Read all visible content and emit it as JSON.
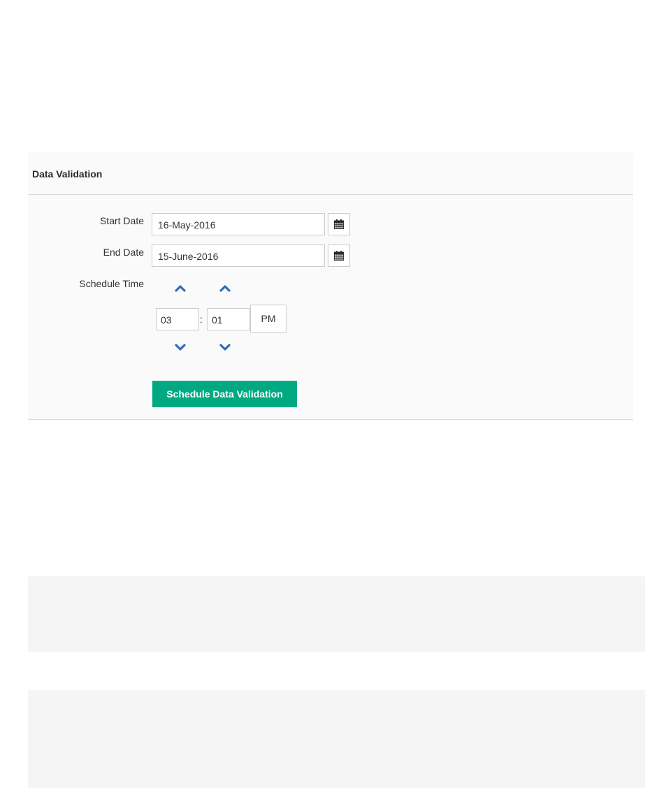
{
  "panel": {
    "title": "Data Validation"
  },
  "form": {
    "start_date": {
      "label": "Start Date",
      "value": "16-May-2016"
    },
    "end_date": {
      "label": "End Date",
      "value": "15-June-2016"
    },
    "schedule_time": {
      "label": "Schedule Time",
      "hour": "03",
      "separator": ":",
      "minute": "01",
      "period": "PM"
    },
    "submit_label": "Schedule Data Validation"
  },
  "icons": {
    "calendar": "calendar-icon",
    "increment": "chevron-up-icon",
    "decrement": "chevron-down-icon"
  },
  "colors": {
    "primary_button": "#01a982",
    "spinner_chevron": "#2f6eb5",
    "panel_background": "#fafafa",
    "lower_blocks": "#f5f5f5"
  }
}
